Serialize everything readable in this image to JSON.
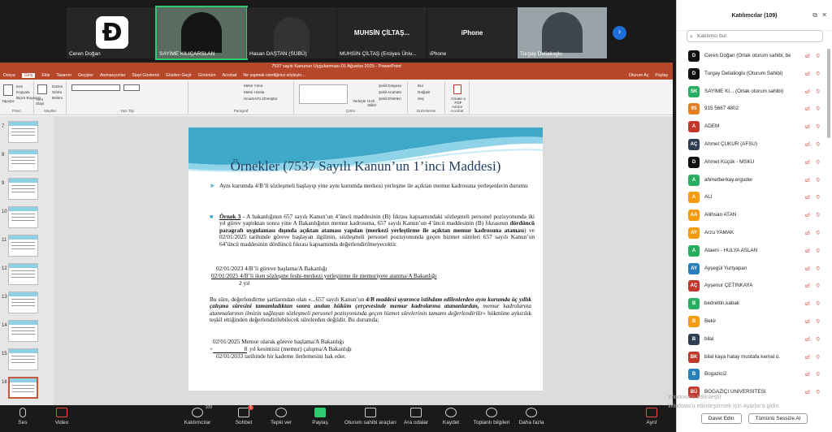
{
  "gallery": {
    "tiles": [
      {
        "name": "Ceren Doğan",
        "kind": "logo"
      },
      {
        "name": "SAYİME KILIÇARSLAN",
        "kind": "video",
        "active": true
      },
      {
        "name": "Hasan DAŞTAN (SUBÜ)",
        "kind": "video"
      },
      {
        "name": "MUHSİN ÇİLTAŞ (Erciyes Üniv...",
        "center": "MUHSİN ÇİLTAŞ...",
        "kind": "name"
      },
      {
        "name": "iPhone",
        "center": "iPhone",
        "kind": "name"
      },
      {
        "name": "Turgay Delialioglu",
        "kind": "video"
      }
    ]
  },
  "ppt": {
    "title": "7537 sayılı Kanunun Uygulanması-01 Ağustos 2025 - PowerPoint",
    "tabs": [
      "Dosya",
      "Giriş",
      "Ekle",
      "Tasarım",
      "Geçişler",
      "Animasyonlar",
      "Slayt Gösterisi",
      "Gözden Geçir",
      "Görünüm",
      "Acrobat"
    ],
    "help": "Ne yapmak istediğinizi söyleyin...",
    "signin": "Oturum Aç",
    "share": "Paylaş",
    "ribbon": {
      "paste": "Yapıştır",
      "cut": "Kes",
      "copy": "Kopyala",
      "painter": "Biçim Boyacısı",
      "clipboard": "Pano",
      "newslide": "Yeni Slayt",
      "layout": "Düzen",
      "reset": "Sıfırla",
      "section": "Bölüm",
      "slides": "Slaytlar",
      "font": "Yazı Tipi",
      "paragraph": "Paragraf",
      "textdir": "Metin Yönü",
      "align": "Metni Hizala",
      "smartart": "SmartArt'a Dönüştür",
      "drawing": "Çizim",
      "arrange": "Yerleştir",
      "quick": "Hızlı Stiller",
      "fill": "Şekil Dolgusu",
      "outline": "Şekil Anahattı",
      "effects": "Şekil Efektleri",
      "find": "Bul",
      "replace": "Değiştir",
      "select": "Seç",
      "editing": "Düzenleme",
      "pdf": "Create a PDF",
      "acrobat": "Adobe Acrobat"
    },
    "thumb_numbers": [
      "7",
      "8",
      "9",
      "10",
      "11",
      "12",
      "13",
      "14",
      "15",
      "16"
    ]
  },
  "slide": {
    "title": "Örnekler (7537 Sayılı Kanun’un 1’inci Maddesi)",
    "bullet1": "Aynı kurumda 4/B’li sözleşmeli başlayıp yine aynı kurumda merkezi yerleşme ile açıktan memur kadrosuna yerleşenlerin durumu",
    "ex_label": "Örnek 3",
    "ex_text": "- A bakanlığının 657 sayılı Kanun’un 4’üncü maddesinin (B) fıkrası kapsamındaki sözleşmeli personel pozisyonunda iki yıl görev yaptıktan sonra yine A Bakanlığının memur kadrosuna, 657 sayılı Kanun’un 4’üncü maddesinin (B) fıkrasının",
    "ex_bold": "dördüncü paragrafı uygulaması dışında açıktan ataması yapılan (merkezi yerleştirme ile açıktan memur kadrosuna ataması",
    "ex_tail": ") ve 02/01/2025 tarihinde göreve başlayan ilgilinin, sözleşmeli personel pozisyonunda geçen hizmet süreleri 657 sayılı Kanun’un 64’üncü maddesinin dördüncü fıkrası kapsamında değerlendirilmeyecektir.",
    "line1": "02/01/2023  4/B’li göreve başlama/A Bakanlığı",
    "line2": "02/01/2025  4/B’li iken sözleşme feshi-merkezi yerleştirme ile memuriyete atanma/A Bakanlığı",
    "line3": "2 yıl",
    "para_lead": "Bu süre, değerlendirme şartlarından olan «...657 sayılı Kanun’un",
    "para_bold": "4/B maddesi uyarınca istihdam edilenlerden aynı kurumda üç yıllık çalışma süresini tamamladıktan sonra anılan hüküm çerçevesinde memur kadrolarına atananlardan,",
    "para_italic": "memur kadrolarına atanmalarının ilmizin sağlayan sözleşmeli personel pozisyonunda geçen hizmet sürelerinin tamamı değerlendirilir»",
    "para_tail": "hükmüne aykırılık teşkil ettiğinden değerlendirilebilecek sürelerden değildir. Bu durumda;",
    "line4": "02/01/2025  Memur olarak göreve başlama/A Bakanlığı",
    "line5a": "+",
    "line5b": "8",
    "line5c": "yıl kesintisiz (memur) çalışma/A Bakanlığı",
    "line6": "02/01/2033  tarihinde bir kademe ilerlemesini hak eder."
  },
  "toolbar": {
    "items": [
      {
        "label": "Ses"
      },
      {
        "label": "Video"
      },
      {
        "label": "Katılımcılar",
        "count": "109"
      },
      {
        "label": "Sohbet",
        "badge": "1"
      },
      {
        "label": "Tepki ver"
      },
      {
        "label": "Paylaş"
      },
      {
        "label": "Oturum sahibi araçları"
      },
      {
        "label": "Ara odalar"
      },
      {
        "label": "Kaydet"
      },
      {
        "label": "Toplantı bilgileri"
      },
      {
        "label": "Daha fazla"
      },
      {
        "label": "Ayrıl"
      }
    ]
  },
  "panel": {
    "title": "Katılımcılar (109)",
    "search_placeholder": "Katılımcı bul",
    "participants": [
      {
        "initials": "D",
        "name": "Ceren Doğan (Ortak oturum sahibi, ben)",
        "color": "#111111"
      },
      {
        "initials": "D",
        "name": "Turgay Delialioglu (Oturum Sahibi)",
        "color": "#111111"
      },
      {
        "initials": "SK",
        "name": "SAYİME KI... (Ortak oturum sahibi)",
        "color": "#27ae60"
      },
      {
        "initials": "95",
        "name": "915 5667 4802",
        "color": "#e67e22"
      },
      {
        "initials": "A",
        "name": "ADEM",
        "color": "#c0392b"
      },
      {
        "initials": "AÇ",
        "name": "Ahmet ÇUKUR (AFSÜ)",
        "color": "#2c3e50"
      },
      {
        "initials": "D",
        "name": "Ahmet Küçük - MSKÜ",
        "color": "#111111"
      },
      {
        "initials": "A",
        "name": "ahmetberkay.erguder",
        "color": "#27ae60"
      },
      {
        "initials": "A",
        "name": "ALİ",
        "color": "#f39c12"
      },
      {
        "initials": "AA",
        "name": "Aliihsan ATAN",
        "color": "#f39c12"
      },
      {
        "initials": "AY",
        "name": "Arzu YAMAK",
        "color": "#f39c12"
      },
      {
        "initials": "A",
        "name": "Ataeni - HÜLYA ASLAN",
        "color": "#27ae60"
      },
      {
        "initials": "AY",
        "name": "Ayşegül Yurtyapan",
        "color": "#2980b9"
      },
      {
        "initials": "AÇ",
        "name": "Ayşenur ÇETİNKAYA",
        "color": "#c0392b"
      },
      {
        "initials": "B",
        "name": "bedrettin.kabak",
        "color": "#27ae60"
      },
      {
        "initials": "B",
        "name": "Bekir",
        "color": "#f39c12"
      },
      {
        "initials": "B",
        "name": "bilal",
        "color": "#2c3e50"
      },
      {
        "initials": "BK",
        "name": "bilal kaya hatay mustafa kemal ü.",
        "color": "#c0392b"
      },
      {
        "initials": "B",
        "name": "Bogazici2",
        "color": "#2980b9"
      },
      {
        "initials": "BÜ",
        "name": "BOĞAZİÇİ ÜNİVERSİTESİ",
        "color": "#c0392b"
      }
    ],
    "btn_host": "Davet Edin",
    "btn_mute": "Tümünü Sessize Al"
  },
  "watermark": {
    "line1": "Windows'u Etkinleştir",
    "line2": "Windows'u etkinleştirmek için Ayarlar'a gidin."
  }
}
